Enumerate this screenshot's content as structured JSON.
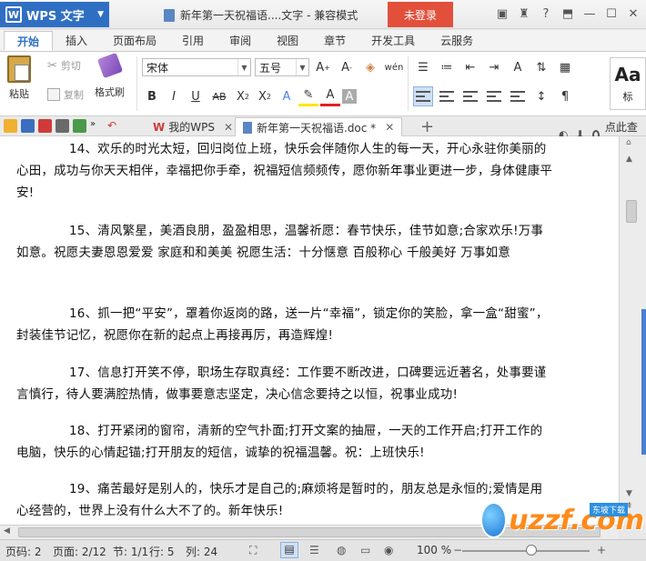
{
  "app": {
    "menu_label": "WPS 文字",
    "doc_title": "新年第一天祝福语....文字 - 兼容模式",
    "login_label": "未登录"
  },
  "ribbon_tabs": [
    "开始",
    "插入",
    "页面布局",
    "引用",
    "审阅",
    "视图",
    "章节",
    "开发工具",
    "云服务"
  ],
  "ribbon": {
    "paste_label": "粘贴",
    "cut_label": "剪切",
    "copy_label": "复制",
    "format_painter_label": "格式刷",
    "font_name": "宋体",
    "font_size": "五号",
    "style_preview": "Aa",
    "style_label": "标"
  },
  "tabs": {
    "home_tab": "我的WPS",
    "doc_tab": "新年第一天祝福语.doc *",
    "search_cmd": "点此查找命令"
  },
  "document": {
    "paragraphs": [
      "14、欢乐的时光太短，回归岗位上班，快乐会伴随你人生的每一天，开心永驻你美丽的心田，成功与你天天相伴，幸福把你手牵，祝福短信频频传，愿你新年事业更进一步，身体健康平安!",
      "15、清风繁星，美酒良朋，盈盈相思，温馨祈愿：春节快乐，佳节如意;合家欢乐!万事如意。祝愿夫妻恩恩爱爱 家庭和和美美 祝愿生活：十分惬意 百般称心 千般美好 万事如意",
      "16、抓一把“平安”，罩着你返岗的路，送一片“幸福”，锁定你的笑脸，拿一盒“甜蜜”，封装佳节记忆，祝愿你在新的起点上再接再厉，再造辉煌!",
      "17、信息打开笑不停，职场生存取真经：工作要不断改进，口碑要远近著名，处事要谨言慎行，待人要满腔热情，做事要意志坚定，决心信念要持之以恒，祝事业成功!",
      "18、打开紧闭的窗帘，清新的空气扑面;打开文案的抽屉，一天的工作开启;打开工作的电脑，快乐的心情起锚;打开朋友的短信，诚挚的祝福温馨。祝：上班快乐!",
      "19、痛苦最好是别人的，快乐才是自己的;麻烦将是暂时的，朋友总是永恒的;爱情是用心经营的，世界上没有什么大不了的。新年快乐!"
    ]
  },
  "status": {
    "page_code": "页码: 2",
    "page": "页面: 2/12",
    "section": "节: 1/1",
    "row": "行: 5",
    "col": "列: 24",
    "zoom": "100 %"
  },
  "logo": {
    "text": "uzzf.com",
    "tag": "东坡下载"
  }
}
